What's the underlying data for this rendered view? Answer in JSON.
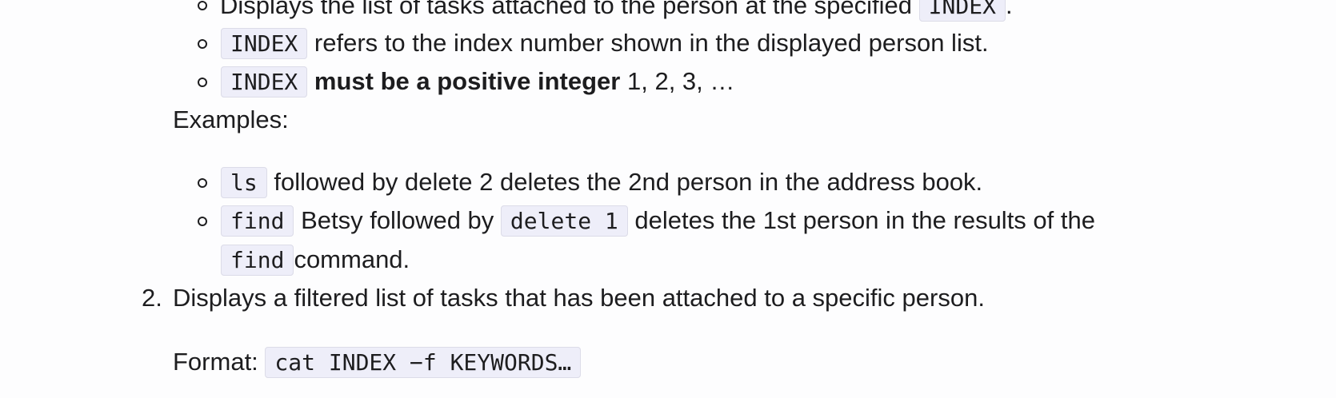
{
  "list1": {
    "item_top": {
      "text": "Displays the list of tasks attached to the person at the specified",
      "code": "INDEX",
      "tail": "."
    },
    "item_index_ref": {
      "code": "INDEX",
      "text": "refers to the index number shown in the displayed person list."
    },
    "item_index_positive": {
      "code": "INDEX",
      "bold": "must be a positive integer",
      "text": "1, 2, 3, …"
    },
    "examples_label": "Examples:",
    "examples": [
      {
        "code": "ls",
        "text": "followed by delete 2 deletes the 2nd person in the address book."
      },
      {
        "code": "find",
        "text_mid": "Betsy followed by",
        "code2": "delete 1",
        "text_end": "deletes the 1st person in the results of the",
        "code3": "find",
        "text_tail": "command."
      }
    ]
  },
  "list2": {
    "number": "2.",
    "text": "Displays a filtered list of tasks that has been attached to a specific person.",
    "format_label": "Format:",
    "format_code": "cat INDEX −f KEYWORDS…"
  }
}
